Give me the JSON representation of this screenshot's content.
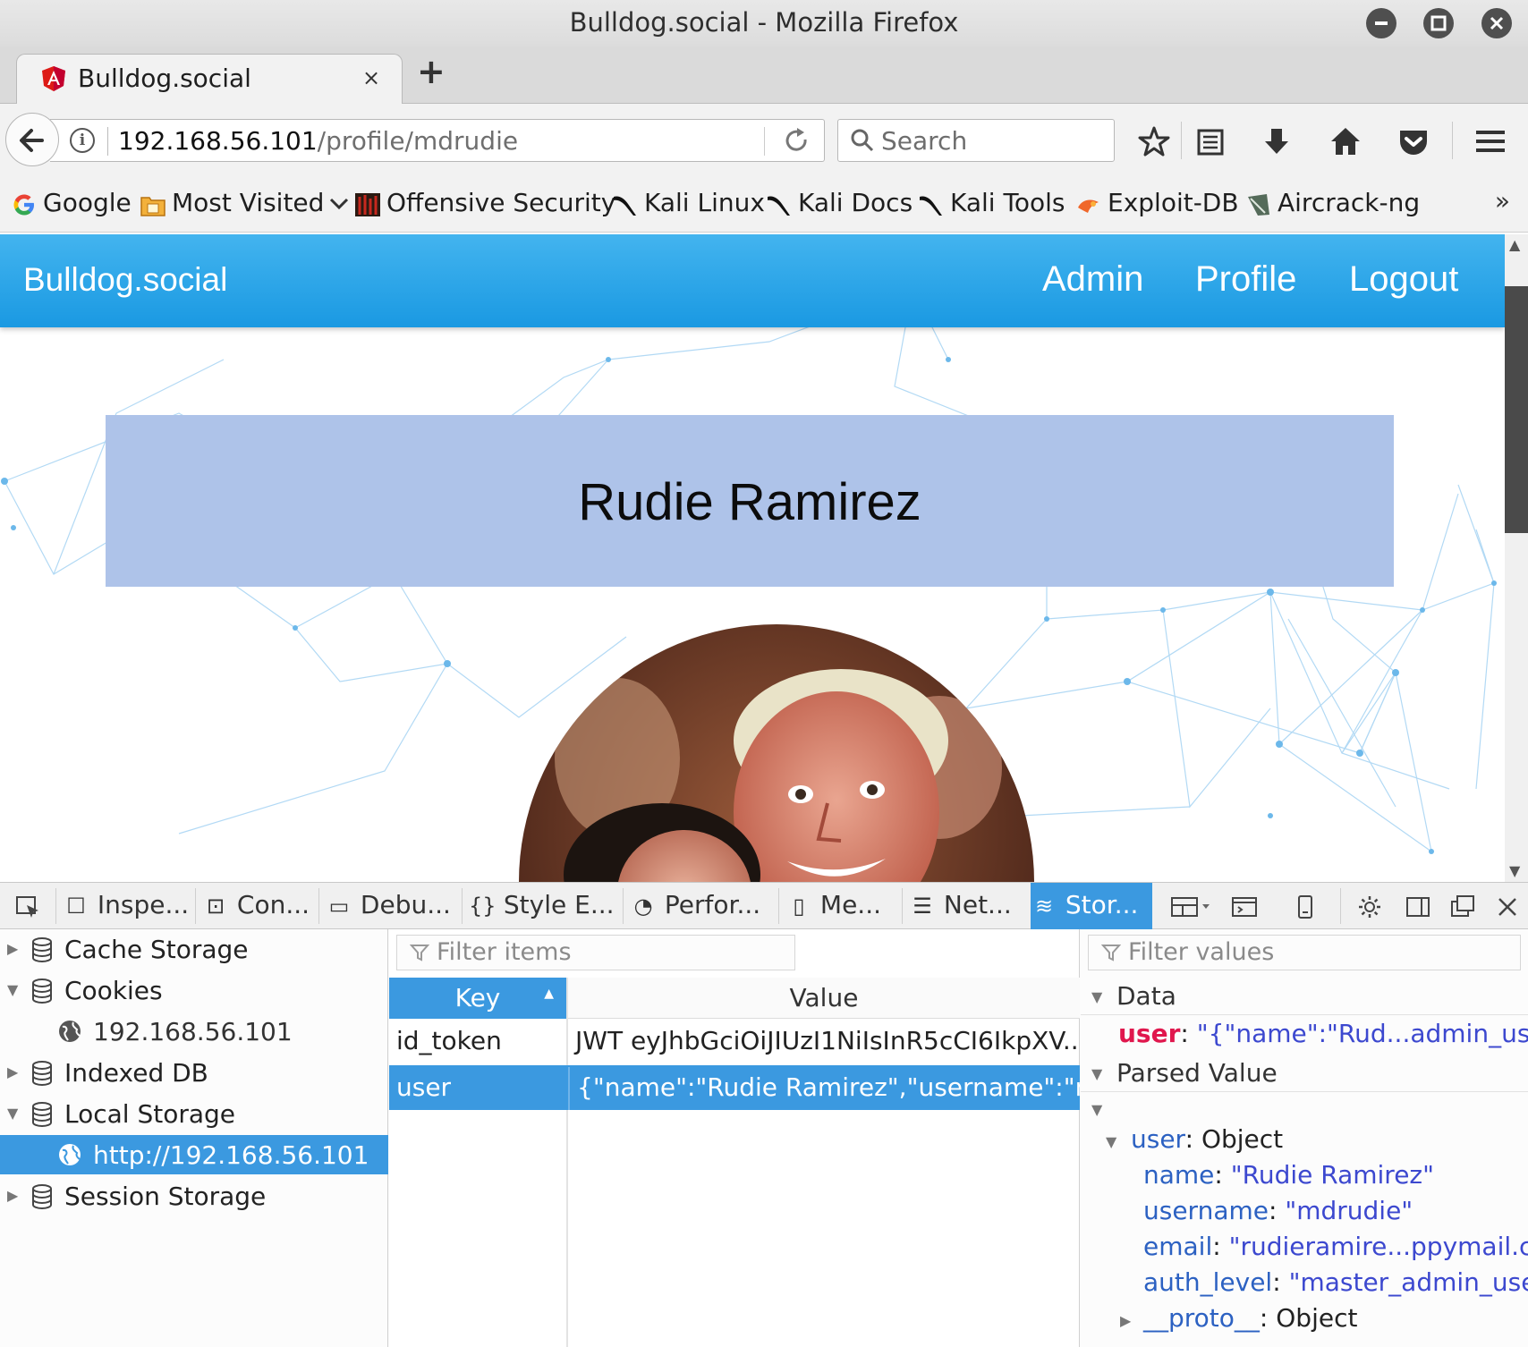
{
  "window": {
    "title": "Bulldog.social - Mozilla Firefox"
  },
  "tab": {
    "title": "Bulldog.social",
    "close": "×",
    "new_tab": "+"
  },
  "urlbar": {
    "host": "192.168.56.101",
    "path": "/profile/mdrudie"
  },
  "searchbar": {
    "placeholder": "Search"
  },
  "bookmarks": [
    {
      "label": "Google",
      "icon": "google-icon"
    },
    {
      "label": "Most Visited",
      "icon": "most-visited-folder-icon"
    },
    {
      "label": "Offensive Security",
      "icon": "offsec-icon"
    },
    {
      "label": "Kali Linux",
      "icon": "kali-dragon-icon"
    },
    {
      "label": "Kali Docs",
      "icon": "kali-dragon-icon"
    },
    {
      "label": "Kali Tools",
      "icon": "kali-dragon-icon"
    },
    {
      "label": "Exploit-DB",
      "icon": "exploitdb-icon"
    },
    {
      "label": "Aircrack-ng",
      "icon": "aircrack-icon"
    }
  ],
  "bookmarks_overflow": "»",
  "site": {
    "brand": "Bulldog.social",
    "nav": [
      "Admin",
      "Profile",
      "Logout"
    ],
    "profile_name": "Rudie Ramirez"
  },
  "devtools": {
    "tabs": [
      {
        "label": "Inspe...",
        "icon": "inspector-icon"
      },
      {
        "label": "Con...",
        "icon": "console-icon"
      },
      {
        "label": "Debu...",
        "icon": "debugger-icon"
      },
      {
        "label": "Style E...",
        "icon": "style-editor-icon"
      },
      {
        "label": "Perfor...",
        "icon": "performance-icon"
      },
      {
        "label": "Me...",
        "icon": "memory-icon"
      },
      {
        "label": "Net...",
        "icon": "network-icon"
      },
      {
        "label": "Stor...",
        "icon": "storage-icon"
      }
    ],
    "tree": [
      {
        "label": "Cache Storage",
        "expanded": false
      },
      {
        "label": "Cookies",
        "expanded": true
      },
      {
        "label": "192.168.56.101",
        "child": true
      },
      {
        "label": "Indexed DB",
        "expanded": false
      },
      {
        "label": "Local Storage",
        "expanded": true
      },
      {
        "label": "http://192.168.56.101",
        "child": true,
        "selected": true
      },
      {
        "label": "Session Storage",
        "expanded": false
      }
    ],
    "filter_items_placeholder": "Filter items",
    "filter_values_placeholder": "Filter values",
    "columns": {
      "key": "Key",
      "value": "Value",
      "sort_indicator": "▲"
    },
    "rows": [
      {
        "key": "id_token",
        "value": "JWT eyJhbGciOiJIUzI1NiIsInR5cCI6IkpXV..."
      },
      {
        "key": "user",
        "value": "{\"name\":\"Rudie Ramirez\",\"username\":\"md..."
      }
    ],
    "sidebar": {
      "data_heading": "Data",
      "data_key": "user",
      "data_value": "\"{\"name\":\"Rud...admin_user\"}\"",
      "parsed_heading": "Parsed Value",
      "object_key": "user",
      "object_type": "Object",
      "props": [
        {
          "key": "name",
          "value": "\"Rudie Ramirez\""
        },
        {
          "key": "username",
          "value": "\"mdrudie\""
        },
        {
          "key": "email",
          "value": "\"rudieramire...ppymail.com\""
        },
        {
          "key": "auth_level",
          "value": "\"master_admin_user\""
        }
      ],
      "proto_key": "__proto__",
      "proto_type": "Object"
    }
  },
  "colors": {
    "accent": "#3b99e0",
    "site_nav": "#2ba3e8",
    "banner": "#aec3e9"
  }
}
